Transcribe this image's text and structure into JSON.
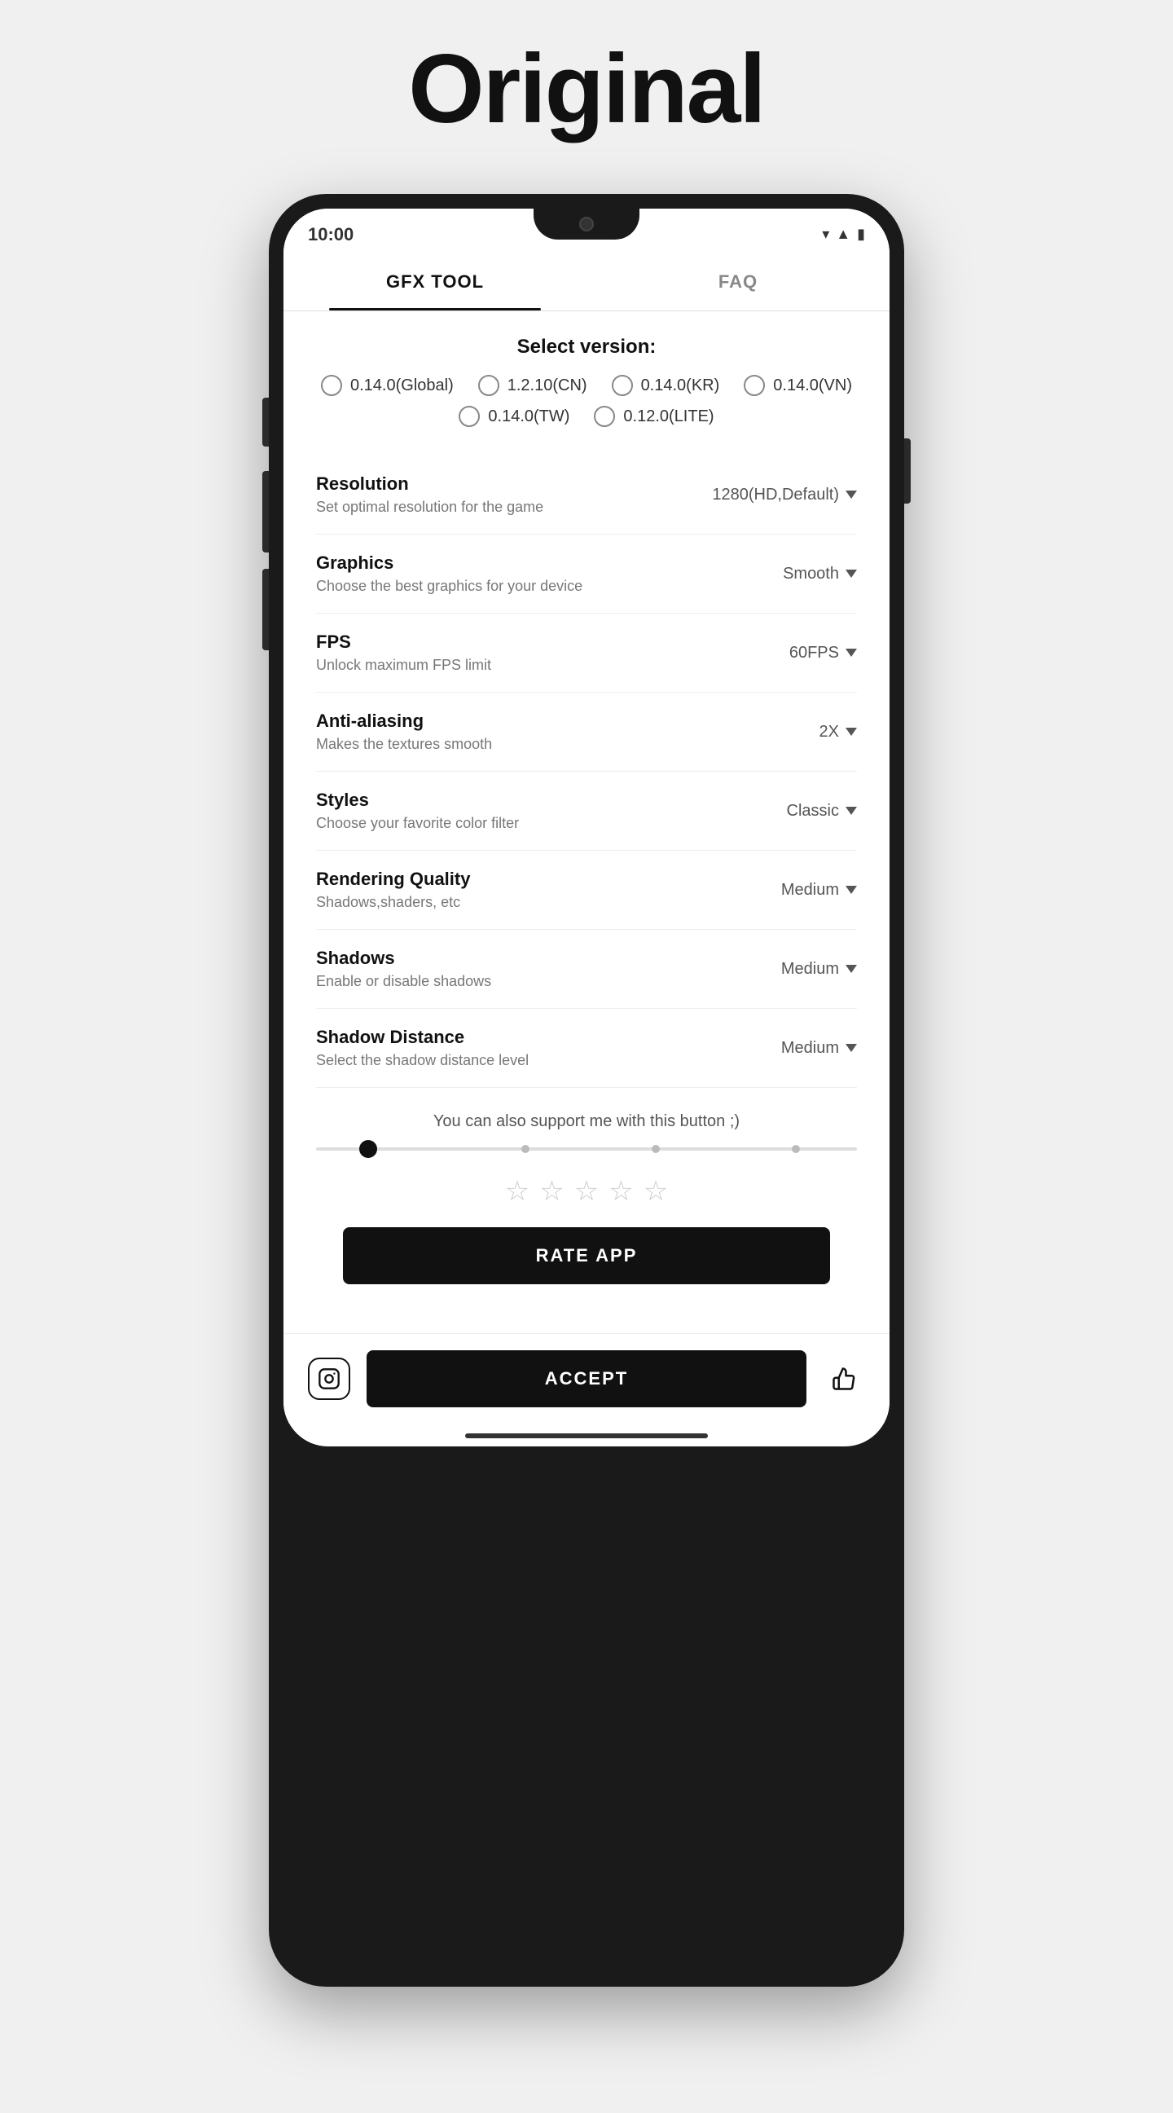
{
  "page": {
    "title": "Original"
  },
  "status_bar": {
    "time": "10:00"
  },
  "tabs": [
    {
      "label": "GFX TOOL",
      "active": true
    },
    {
      "label": "FAQ",
      "active": false
    }
  ],
  "select_version": {
    "title": "Select version:",
    "options": [
      {
        "label": "0.14.0(Global)"
      },
      {
        "label": "1.2.10(CN)"
      },
      {
        "label": "0.14.0(KR)"
      },
      {
        "label": "0.14.0(VN)"
      },
      {
        "label": "0.14.0(TW)"
      },
      {
        "label": "0.12.0(LITE)"
      }
    ]
  },
  "settings": [
    {
      "label": "Resolution",
      "desc": "Set optimal resolution for the game",
      "value": "1280(HD,Default)"
    },
    {
      "label": "Graphics",
      "desc": "Choose the best graphics for your device",
      "value": "Smooth"
    },
    {
      "label": "FPS",
      "desc": "Unlock maximum FPS limit",
      "value": "60FPS"
    },
    {
      "label": "Anti-aliasing",
      "desc": "Makes the textures smooth",
      "value": "2X"
    },
    {
      "label": "Styles",
      "desc": "Choose your favorite color filter",
      "value": "Classic"
    },
    {
      "label": "Rendering Quality",
      "desc": "Shadows,shaders, etc",
      "value": "Medium"
    },
    {
      "label": "Shadows",
      "desc": "Enable or disable shadows",
      "value": "Medium"
    },
    {
      "label": "Shadow Distance",
      "desc": "Select the shadow distance level",
      "value": "Medium"
    }
  ],
  "support": {
    "text": "You can also support me with this button ;)"
  },
  "rate": {
    "label": "RATE APP"
  },
  "bottom": {
    "accept_label": "ACCEPT"
  }
}
